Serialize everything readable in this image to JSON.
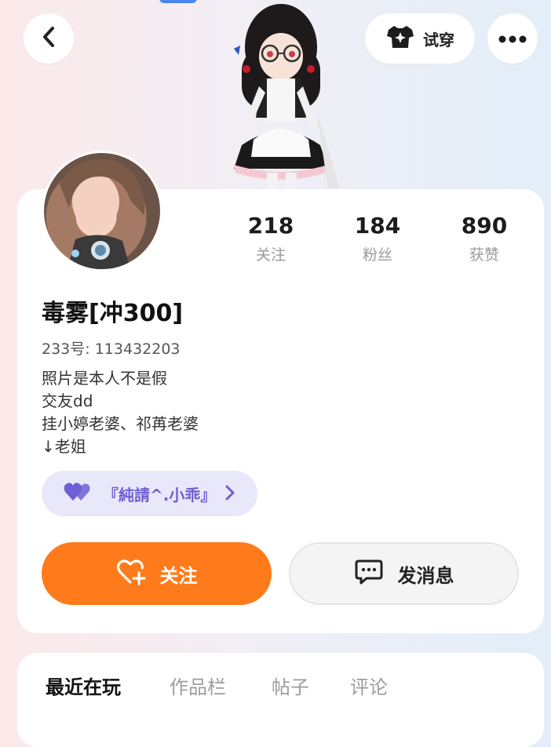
{
  "topbar": {
    "tryon_label": "试穿"
  },
  "profile": {
    "username": "毒雾[冲300]",
    "uid_label": "233号:",
    "uid_value": "113432203",
    "bio": [
      "照片是本人不是假",
      "交友dd",
      "挂小婷老婆、祁苒老婆",
      "↓老姐"
    ]
  },
  "stats": [
    {
      "value": "218",
      "label": "关注"
    },
    {
      "value": "184",
      "label": "粉丝"
    },
    {
      "value": "890",
      "label": "获赞"
    }
  ],
  "group": {
    "name": "『純請^.小乖』"
  },
  "actions": {
    "follow_label": "关注",
    "message_label": "发消息"
  },
  "tabs": [
    {
      "label": "最近在玩",
      "active": true
    },
    {
      "label": "作品栏",
      "active": false
    },
    {
      "label": "帖子",
      "active": false
    },
    {
      "label": "评论",
      "active": false
    }
  ],
  "colors": {
    "accent_orange": "#ff7a1a",
    "chip_bg": "#e9e8fb",
    "chip_text": "#6e5fd4"
  }
}
